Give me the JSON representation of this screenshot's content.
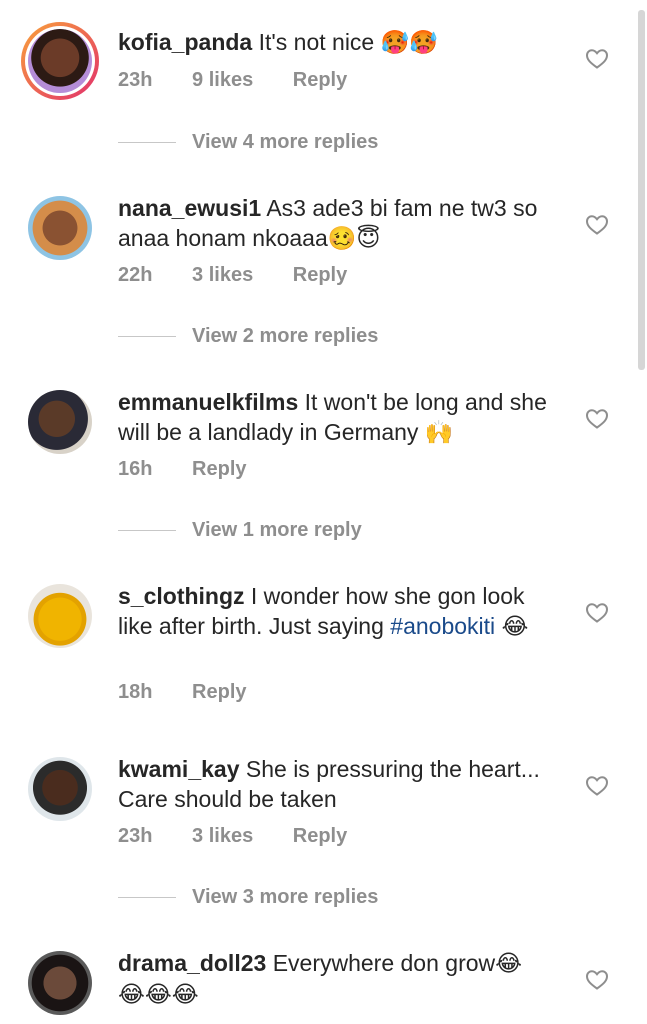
{
  "comments": [
    {
      "username": "kofia_panda",
      "text": "It's not nice",
      "emoji": "🥵🥵",
      "time": "23h",
      "likes": "9 likes",
      "reply": "Reply",
      "replies": "View 4 more replies"
    },
    {
      "username": "nana_ewusi1",
      "text": "As3 ade3 bi fam ne tw3 so anaa honam nkoaaa",
      "emoji": "🥴😇",
      "time": "22h",
      "likes": "3 likes",
      "reply": "Reply",
      "replies": "View 2 more replies"
    },
    {
      "username": "emmanuelkfilms",
      "text": "It won't be long and she will be a landlady in Germany",
      "emoji": "🙌",
      "time": "16h",
      "reply": "Reply",
      "replies": "View 1 more reply"
    },
    {
      "username": "s_clothingz",
      "text": "I wonder how she gon look like after birth. Just saying",
      "hashtag": "#anobokiti",
      "emoji": "😂",
      "time": "18h",
      "reply": "Reply"
    },
    {
      "username": "kwami_kay",
      "text": "She is pressuring the heart... Care should be taken",
      "time": "23h",
      "likes": "3 likes",
      "reply": "Reply",
      "replies": "View 3 more replies"
    },
    {
      "username": "drama_doll23",
      "text": "Everywhere don grow",
      "emoji": "😂",
      "emoji2": "😂😂😂"
    }
  ],
  "icons": {
    "like": "heart-outline-icon"
  },
  "colors": {
    "meta": "#8e8e8e",
    "hashtag": "#1a4a8a",
    "story_ring": "#e1306c"
  }
}
